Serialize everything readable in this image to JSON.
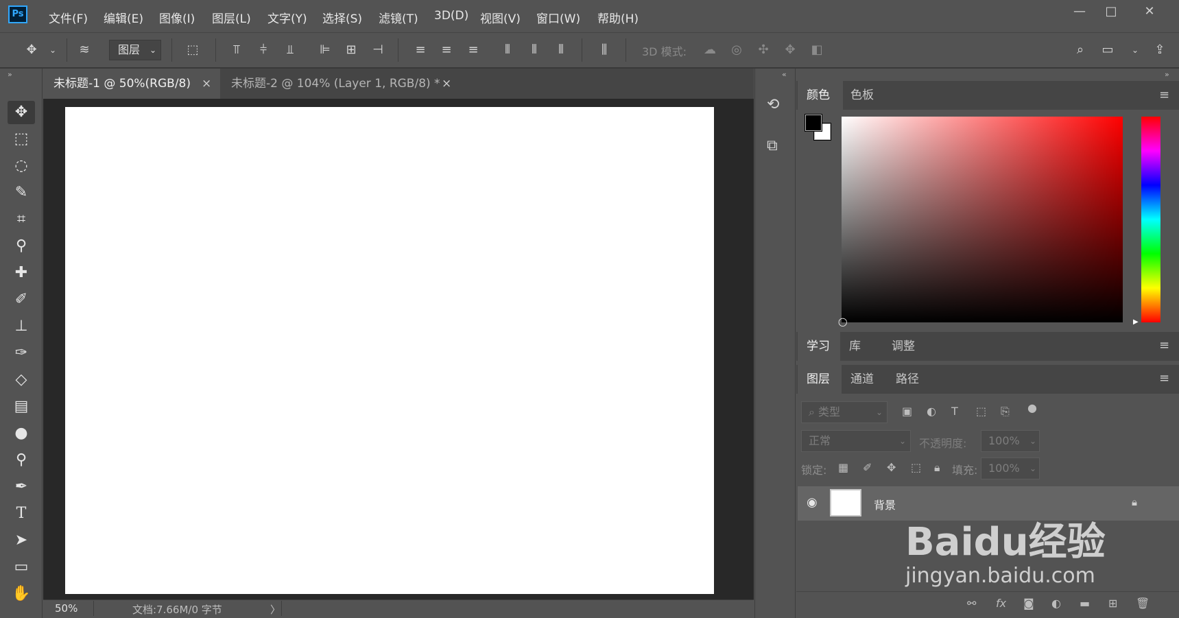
{
  "app": {
    "logo_text": "Ps"
  },
  "menu": [
    "文件(F)",
    "编辑(E)",
    "图像(I)",
    "图层(L)",
    "文字(Y)",
    "选择(S)",
    "滤镜(T)",
    "3D(D)",
    "视图(V)",
    "窗口(W)",
    "帮助(H)"
  ],
  "window_controls": {
    "minimize": "—",
    "maximize": "□",
    "close": "✕"
  },
  "options_bar": {
    "auto_select_target": "图层",
    "mode_3d_label": "3D 模式:"
  },
  "tabs": [
    {
      "label": "未标题-1 @ 50%(RGB/8)",
      "close": "×",
      "active": true
    },
    {
      "label": "未标题-2 @ 104% (Layer 1, RGB/8) *",
      "close": "×",
      "active": false
    }
  ],
  "status": {
    "zoom": "50%",
    "doc_info": "文档:7.66M/0 字节",
    "arrow": "〉"
  },
  "color_panel": {
    "tabs": [
      "颜色",
      "色板"
    ],
    "foreground": "#000000",
    "background": "#ffffff"
  },
  "learn_panel": {
    "tabs": [
      "学习",
      "库",
      "调整"
    ]
  },
  "layers_panel": {
    "tabs": [
      "图层",
      "通道",
      "路径"
    ],
    "filter_type": "类型",
    "blend_mode": "正常",
    "opacity_label": "不透明度:",
    "opacity_value": "100%",
    "lock_label": "锁定:",
    "fill_label": "填充:",
    "fill_value": "100%",
    "layers": [
      {
        "name": "背景",
        "visible": true,
        "locked": true
      }
    ]
  },
  "watermark": {
    "text": "Baidu经验",
    "url": "jingyan.baidu.com"
  },
  "colors": {
    "accent": "#31a8ff",
    "panel": "#535353",
    "dark": "#282828"
  }
}
